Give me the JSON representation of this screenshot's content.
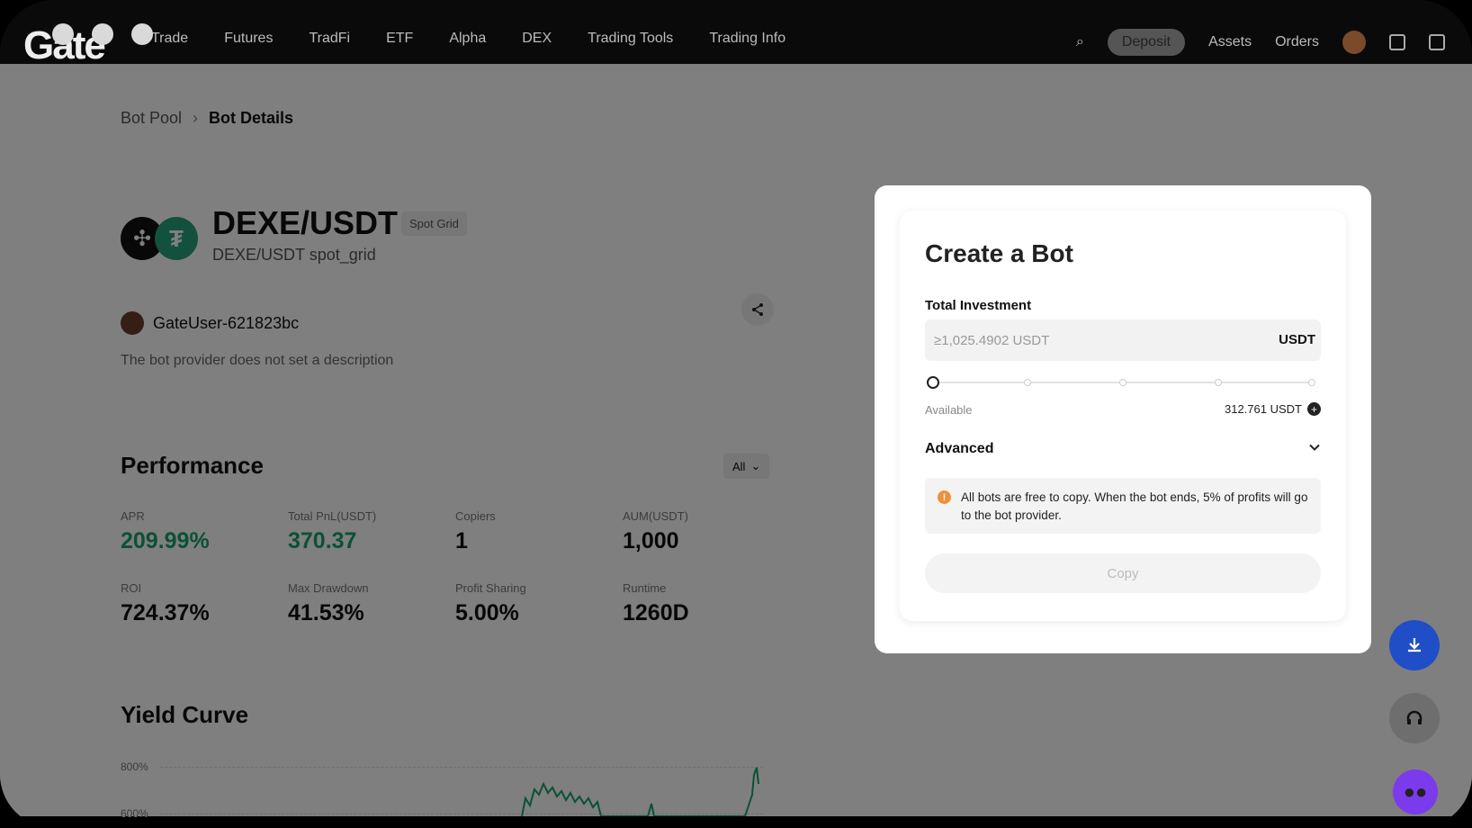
{
  "nav": {
    "logo": "Gate",
    "items": [
      "Trade",
      "Futures",
      "TradFi",
      "ETF",
      "Alpha",
      "DEX",
      "Trading Tools",
      "Trading Info"
    ],
    "right": {
      "deposit": "Deposit",
      "assets": "Assets",
      "orders": "Orders"
    }
  },
  "breadcrumb": {
    "parent": "Bot Pool",
    "separator": "›",
    "current": "Bot Details"
  },
  "bot": {
    "pair": "DEXE/USDT",
    "tag": "Spot Grid",
    "subtitle": "DEXE/USDT spot_grid",
    "user": "GateUser-621823bc",
    "description": "The bot provider does not set a description"
  },
  "performance": {
    "title": "Performance",
    "filter": "All",
    "stats": [
      {
        "label": "APR",
        "value": "209.99%",
        "positive": true
      },
      {
        "label": "Total PnL(USDT)",
        "value": "370.37",
        "positive": true
      },
      {
        "label": "Copiers",
        "value": "1",
        "positive": false
      },
      {
        "label": "AUM(USDT)",
        "value": "1,000",
        "positive": false
      },
      {
        "label": "ROI",
        "value": "724.37%",
        "positive": false
      },
      {
        "label": "Max Drawdown",
        "value": "41.53%",
        "positive": false
      },
      {
        "label": "Profit Sharing",
        "value": "5.00%",
        "positive": false
      },
      {
        "label": "Runtime",
        "value": "1260D",
        "positive": false
      }
    ]
  },
  "yield_curve": {
    "title": "Yield Curve",
    "ticks": [
      "800%",
      "600%"
    ]
  },
  "modal": {
    "title": "Create a Bot",
    "investment_label": "Total Investment",
    "investment_placeholder": "≥1,025.4902 USDT",
    "investment_unit": "USDT",
    "slider_percent": 0,
    "available_label": "Available",
    "available_value": "312.761 USDT",
    "advanced_label": "Advanced",
    "notice": "All bots are free to copy. When the bot ends, 5% of profits will go to the bot provider.",
    "copy_button": "Copy"
  },
  "colors": {
    "positive": "#17a36b",
    "fab_download": "#1f4ec6",
    "notice_warn": "#f0903a"
  },
  "icons": {
    "share": "share-icon",
    "download": "download-icon",
    "support": "headset-icon",
    "bot": "bot-icon"
  }
}
